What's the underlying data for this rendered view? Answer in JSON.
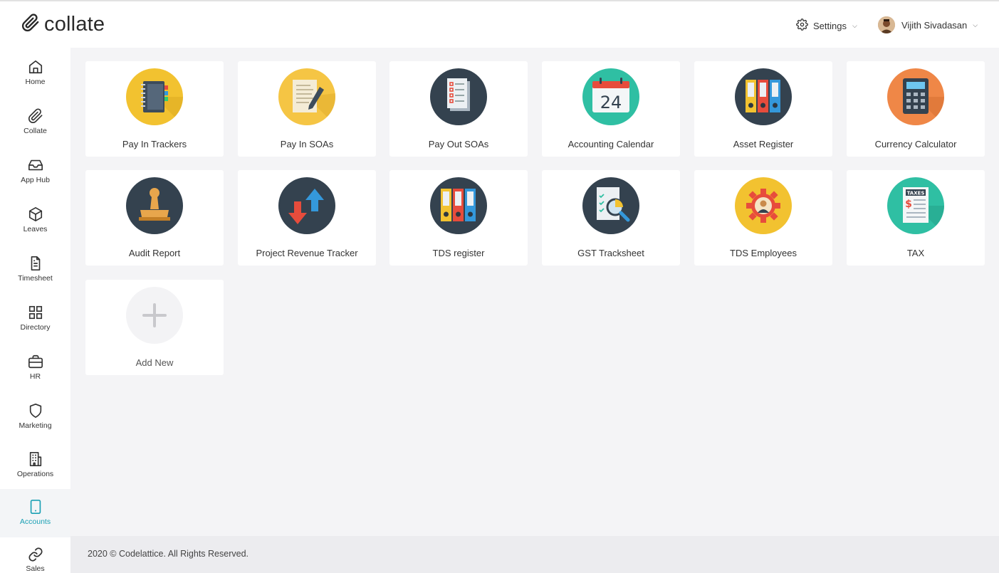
{
  "app": {
    "name": "collate"
  },
  "header": {
    "settings_label": "Settings",
    "user_name": "Vijith Sivadasan"
  },
  "sidebar": {
    "items": [
      {
        "label": "Home",
        "icon": "home-icon"
      },
      {
        "label": "Collate",
        "icon": "paperclip-icon"
      },
      {
        "label": "App Hub",
        "icon": "inbox-icon"
      },
      {
        "label": "Leaves",
        "icon": "box-icon"
      },
      {
        "label": "Timesheet",
        "icon": "document-icon"
      },
      {
        "label": "Directory",
        "icon": "grid-icon"
      },
      {
        "label": "HR",
        "icon": "briefcase-icon"
      },
      {
        "label": "Marketing",
        "icon": "shield-icon"
      },
      {
        "label": "Operations",
        "icon": "building-icon"
      },
      {
        "label": "Accounts",
        "icon": "tablet-icon"
      },
      {
        "label": "Sales",
        "icon": "link-icon"
      }
    ],
    "active": "Accounts",
    "accent_color": "#1aa0b4"
  },
  "apps": [
    {
      "label": "Pay In Trackers",
      "icon": "notebook-icon",
      "color": "#f2c230"
    },
    {
      "label": "Pay In SOAs",
      "icon": "document-pen-icon",
      "color": "#f5c544"
    },
    {
      "label": "Pay Out SOAs",
      "icon": "checklist-icon",
      "color": "#34424f"
    },
    {
      "label": "Accounting Calendar",
      "icon": "calendar-icon",
      "color": "#2fbfa3"
    },
    {
      "label": "Asset Register",
      "icon": "binders-icon",
      "color": "#34424f"
    },
    {
      "label": "Currency Calculator",
      "icon": "calculator-icon",
      "color": "#ef8747"
    },
    {
      "label": "Audit Report",
      "icon": "stamp-icon",
      "color": "#34424f"
    },
    {
      "label": "Project Revenue Tracker",
      "icon": "arrows-icon",
      "color": "#34424f"
    },
    {
      "label": "TDS register",
      "icon": "binders-icon",
      "color": "#34424f"
    },
    {
      "label": "GST Tracksheet",
      "icon": "magnifier-report-icon",
      "color": "#34424f"
    },
    {
      "label": "TDS Employees",
      "icon": "gear-person-icon",
      "color": "#f2c230"
    },
    {
      "label": "TAX",
      "icon": "tax-sheet-icon",
      "color": "#2fbfa3"
    }
  ],
  "add_new": {
    "label": "Add New",
    "icon": "plus-icon"
  },
  "calendar_day": "24",
  "tax_banner": "TAXES",
  "footer": {
    "text": "2020 © Codelattice. All Rights Reserved."
  }
}
